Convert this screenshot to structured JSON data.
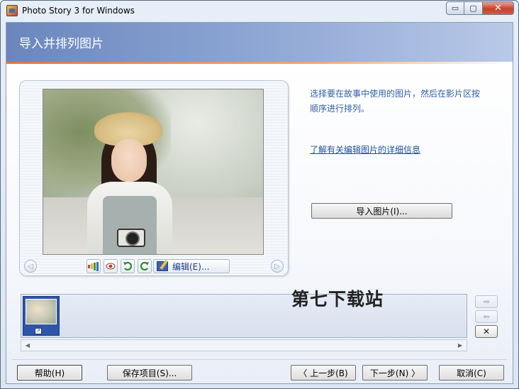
{
  "window": {
    "title": "Photo Story 3 for Windows",
    "controls": {
      "minimize": "▭",
      "maximize": "▢",
      "close": "✕"
    }
  },
  "header": {
    "title": "导入并排列图片"
  },
  "preview": {
    "nav_left": "◁",
    "nav_right": "▷",
    "edit_label": "编辑(E)..."
  },
  "side": {
    "instructions": "选择要在故事中使用的图片，然后在影片区按顺序进行排列。",
    "learn_link": "了解有关编辑图片的详细信息",
    "import_label": "导入图片(I)..."
  },
  "filmstrip": {
    "watermark": "第七下载站",
    "move_right": "➡",
    "move_left": "⬅",
    "delete": "✕",
    "scroll_left": "◀",
    "scroll_right": "▶"
  },
  "buttons": {
    "help": "帮助(H)",
    "save": "保存项目(S)...",
    "prev": "〈 上一步(B)",
    "next": "下一步(N) 〉",
    "cancel": "取消(C)"
  },
  "colors": {
    "header_start": "#6a86bd",
    "accent_line": "#e8743b",
    "link": "#1f4f9e",
    "thumb_selected": "#2d55a8"
  }
}
